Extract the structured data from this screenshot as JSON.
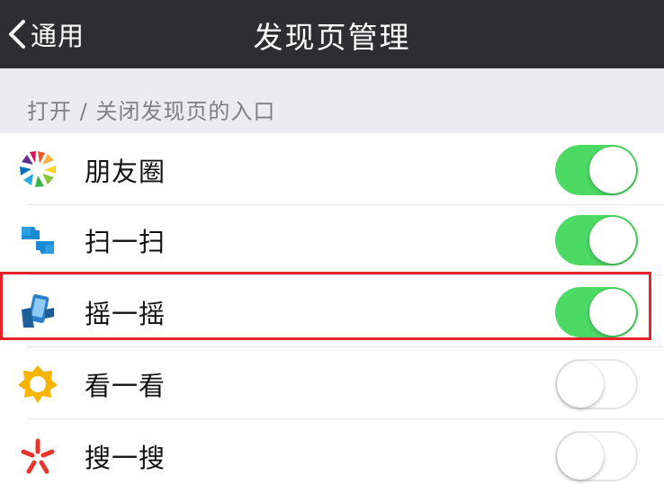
{
  "nav": {
    "back_label": "通用",
    "title": "发现页管理",
    "background_color": "#2e2e32"
  },
  "section": {
    "header": "打开 / 关闭发现页的入口"
  },
  "items": [
    {
      "label": "朋友圈",
      "icon": "moments-aperture-icon",
      "enabled": true
    },
    {
      "label": "扫一扫",
      "icon": "scan-icon",
      "enabled": true
    },
    {
      "label": "摇一摇",
      "icon": "shake-icon",
      "enabled": true,
      "highlighted": true
    },
    {
      "label": "看一看",
      "icon": "top-stories-icon",
      "enabled": false
    },
    {
      "label": "搜一搜",
      "icon": "search-spark-icon",
      "enabled": false
    }
  ],
  "colors": {
    "toggle_on": "#4cd964",
    "highlight_border": "#e8222a"
  }
}
